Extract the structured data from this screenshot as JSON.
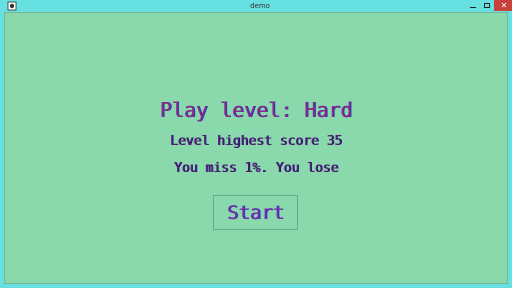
{
  "window": {
    "title": "demo",
    "close_glyph": "✕",
    "icon": "app-icon"
  },
  "game": {
    "heading": "Play level: Hard",
    "score_line": "Level highest score 35",
    "result_line": "You miss 1%. You lose",
    "start_label": "Start"
  }
}
